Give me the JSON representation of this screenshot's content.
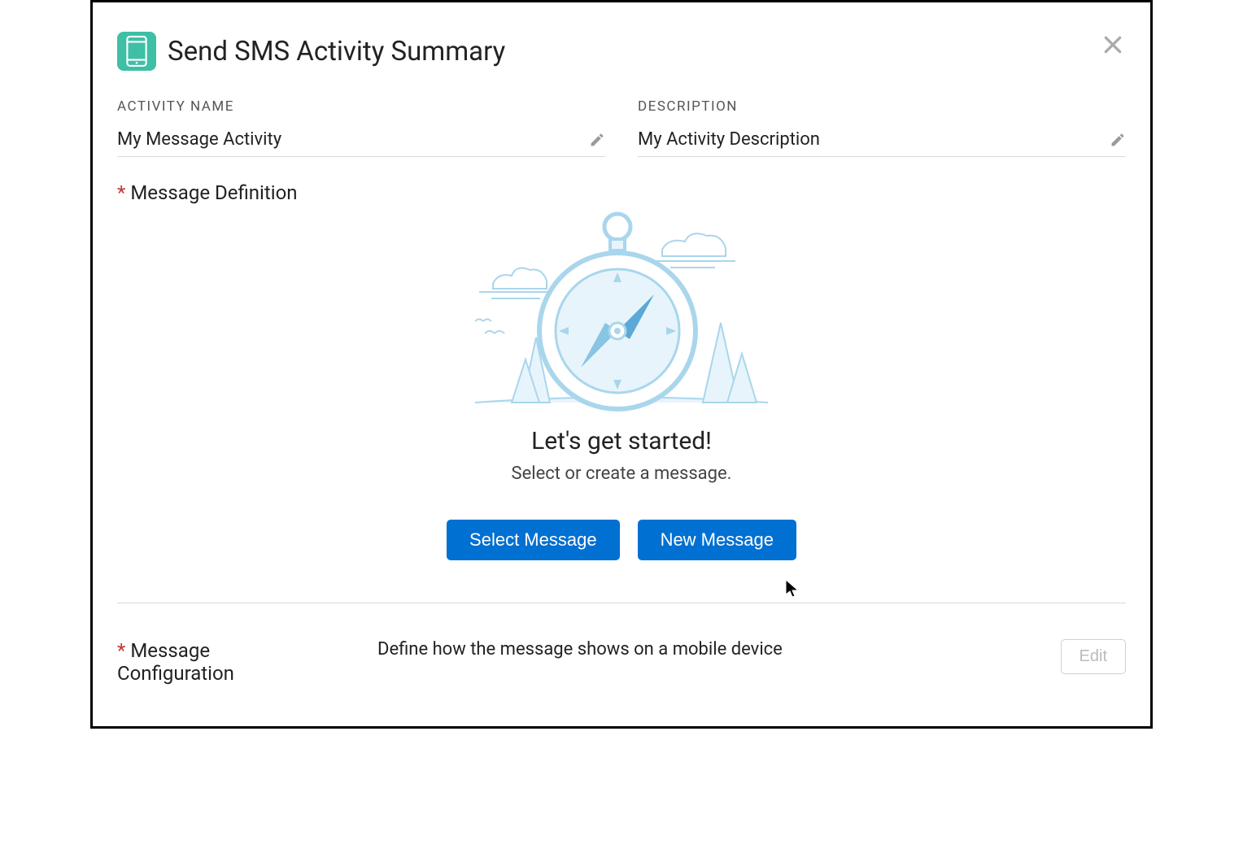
{
  "header": {
    "title": "Send SMS Activity Summary"
  },
  "fields": {
    "activity_name": {
      "label": "ACTIVITY NAME",
      "value": "My Message Activity"
    },
    "description": {
      "label": "DESCRIPTION",
      "value": "My Activity Description"
    }
  },
  "message_definition": {
    "title": "Message Definition",
    "heading": "Let's get started!",
    "subheading": "Select or create a message.",
    "select_btn": "Select Message",
    "new_btn": "New Message"
  },
  "message_configuration": {
    "title": "Message Configuration",
    "description": "Define how the message shows on a mobile device",
    "edit_btn": "Edit"
  }
}
